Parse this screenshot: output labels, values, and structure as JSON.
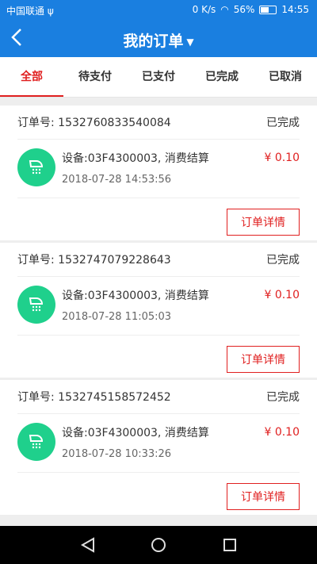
{
  "status_bar": {
    "carrier": "中国联通 ψ",
    "speed": "0 K/s",
    "battery": "56%",
    "time": "14:55"
  },
  "header": {
    "title": "我的订单"
  },
  "tabs": [
    {
      "label": "全部",
      "active": true
    },
    {
      "label": "待支付"
    },
    {
      "label": "已支付"
    },
    {
      "label": "已完成"
    },
    {
      "label": "已取消"
    }
  ],
  "orders": [
    {
      "order_label": "订单号: 1532760833540084",
      "status": "已完成",
      "device": "设备:03F4300003, 消费结算",
      "time": "2018-07-28 14:53:56",
      "price": "¥ 0.10",
      "detail_label": "订单详情"
    },
    {
      "order_label": "订单号: 1532747079228643",
      "status": "已完成",
      "device": "设备:03F4300003, 消费结算",
      "time": "2018-07-28 11:05:03",
      "price": "¥ 0.10",
      "detail_label": "订单详情"
    },
    {
      "order_label": "订单号: 1532745158572452",
      "status": "已完成",
      "device": "设备:03F4300003, 消费结算",
      "time": "2018-07-28 10:33:26",
      "price": "¥ 0.10",
      "detail_label": "订单详情"
    }
  ],
  "colors": {
    "primary": "#1a7fe0",
    "accent": "#e02020",
    "icon_bg": "#1fd08c"
  },
  "icons": {
    "order_icon": "shower-icon"
  }
}
